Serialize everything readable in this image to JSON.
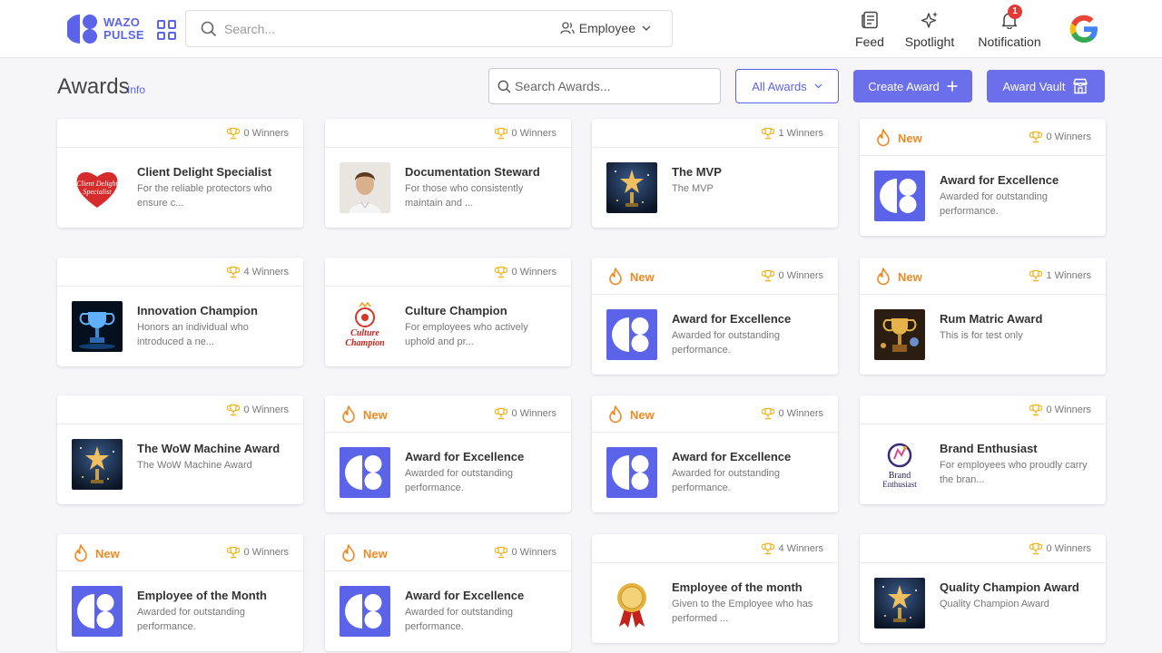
{
  "brand": {
    "line1": "WAZO",
    "line2": "PULSE",
    "color": "#5b63e8"
  },
  "search": {
    "placeholder": "Search...",
    "filter_label": "Employee"
  },
  "nav": {
    "feed": "Feed",
    "spotlight": "Spotlight",
    "notification": "Notification",
    "notification_count": "1"
  },
  "page": {
    "title": "Awards",
    "info": "Info",
    "search_placeholder": "Search Awards...",
    "filter_label": "All Awards",
    "create_label": "Create Award",
    "vault_label": "Award Vault"
  },
  "labels": {
    "new": "New"
  },
  "cards": [
    {
      "title": "Client Delight Specialist",
      "desc": "For the reliable protectors who ensure c...",
      "winners": "0 Winners",
      "new": false,
      "image": "client-delight-heart"
    },
    {
      "title": "Documentation Steward",
      "desc": "For those who consistently maintain and ...",
      "winners": "0 Winners",
      "new": false,
      "image": "person-photo"
    },
    {
      "title": "The MVP",
      "desc": "The MVP",
      "winners": "1 Winners",
      "new": false,
      "image": "star-trophy"
    },
    {
      "title": "Award for Excellence",
      "desc": "Awarded for outstanding performance.",
      "winners": "0 Winners",
      "new": true,
      "image": "wazo-logo"
    },
    {
      "title": "Innovation Champion",
      "desc": "Honors an individual who introduced a ne...",
      "winners": "4 Winners",
      "new": false,
      "image": "blue-trophy"
    },
    {
      "title": "Culture Champion",
      "desc": "For employees who actively uphold and pr...",
      "winners": "0 Winners",
      "new": false,
      "image": "culture-champion-badge"
    },
    {
      "title": "Award for Excellence",
      "desc": "Awarded for outstanding performance.",
      "winners": "0 Winners",
      "new": true,
      "image": "wazo-logo"
    },
    {
      "title": "Rum Matric Award",
      "desc": "This is for test only",
      "winners": "1 Winners",
      "new": true,
      "image": "gold-trophy"
    },
    {
      "title": "The WoW Machine Award",
      "desc": "The WoW Machine Award",
      "winners": "0 Winners",
      "new": false,
      "image": "star-trophy"
    },
    {
      "title": "Award for Excellence",
      "desc": "Awarded for outstanding performance.",
      "winners": "0 Winners",
      "new": true,
      "image": "wazo-logo"
    },
    {
      "title": "Award for Excellence",
      "desc": "Awarded for outstanding performance.",
      "winners": "0 Winners",
      "new": true,
      "image": "wazo-logo"
    },
    {
      "title": "Brand Enthusiast",
      "desc": "For employees who proudly carry the bran...",
      "winners": "0 Winners",
      "new": false,
      "image": "brand-enthusiast-badge"
    },
    {
      "title": "Employee of the Month",
      "desc": "Awarded for outstanding performance.",
      "winners": "0 Winners",
      "new": true,
      "image": "wazo-logo"
    },
    {
      "title": "Award for Excellence",
      "desc": "Awarded for outstanding performance.",
      "winners": "0 Winners",
      "new": true,
      "image": "wazo-logo"
    },
    {
      "title": "Employee of the month",
      "desc": "Given to the Employee who has performed ...",
      "winners": "4 Winners",
      "new": false,
      "image": "gold-medal"
    },
    {
      "title": "Quality Champion Award",
      "desc": "Quality Champion Award",
      "winners": "0 Winners",
      "new": false,
      "image": "star-trophy"
    }
  ],
  "colors": {
    "accent": "#5b63e8",
    "button": "#6b70ea",
    "new": "#f08a24",
    "trophy": "#f2b51c"
  }
}
